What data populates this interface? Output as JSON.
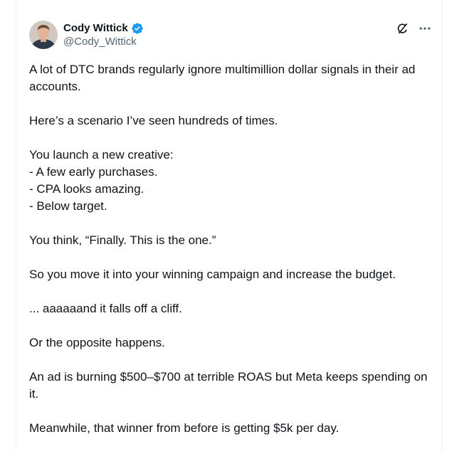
{
  "post": {
    "author": {
      "display_name": "Cody Wittick",
      "handle": "@Cody_Wittick",
      "verified": true
    },
    "colors": {
      "verified_badge": "#1d9bf0",
      "text": "#0f1419",
      "secondary_text": "#536471"
    },
    "actions": [
      {
        "icon": "grok-icon"
      },
      {
        "icon": "more-icon"
      }
    ],
    "paragraphs": [
      "A lot of DTC brands regularly ignore multimillion dollar signals in their ad accounts.",
      "Here’s a scenario I’ve seen hundreds of times.",
      "You launch a new creative:\n- A few early purchases.\n- CPA looks amazing.\n- Below target.",
      "You think, “Finally. This is the one.”",
      "So you move it into your winning campaign and increase the budget.",
      "... aaaaaand it falls off a cliff.",
      "Or the opposite happens.",
      "An ad is burning $500–$700 at terrible ROAS but Meta keeps spending on it.",
      "Meanwhile, that winner from before is getting $5k per day."
    ]
  }
}
